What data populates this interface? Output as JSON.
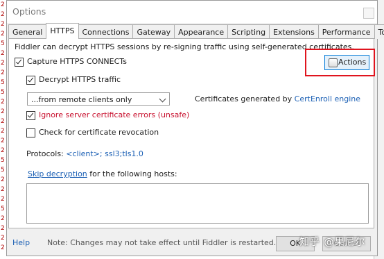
{
  "window": {
    "title": "Options"
  },
  "background": {
    "left_chars": [
      "2",
      "2",
      "2",
      "2",
      "5",
      "2",
      "2",
      "2",
      "5",
      "5",
      "2",
      "2",
      "2",
      "2",
      "2",
      "2",
      "5",
      "5",
      "2",
      "2",
      "2",
      "5",
      "2",
      "2",
      "2",
      "2",
      "2"
    ]
  },
  "tabs": [
    {
      "label": "General"
    },
    {
      "label": "HTTPS",
      "active": true
    },
    {
      "label": "Connections"
    },
    {
      "label": "Gateway"
    },
    {
      "label": "Appearance"
    },
    {
      "label": "Scripting"
    },
    {
      "label": "Extensions"
    },
    {
      "label": "Performance"
    },
    {
      "label": "Tools"
    }
  ],
  "https": {
    "intro": "Fiddler can decrypt HTTPS sessions by re-signing traffic using self-generated certificates.",
    "capture_label": "Capture HTTPS CONNECTs",
    "decrypt_label": "Decrypt HTTPS traffic",
    "source_select": "...from remote clients only",
    "cert_prefix": "Certificates generated by",
    "cert_engine": "CertEnroll engine",
    "ignore_errors_label": "Ignore server certificate errors (unsafe)",
    "revocation_label": "Check for certificate revocation",
    "protocols_label": "Protocols:",
    "protocols_value": "<client>; ssl3;tls1.0",
    "skip_link": "Skip decryption",
    "skip_suffix": "for the following hosts:",
    "actions_label": "Actions",
    "capture_checked": true,
    "decrypt_checked": true,
    "ignore_checked": true,
    "revocation_checked": false
  },
  "footer": {
    "help": "Help",
    "note": "Note: Changes may not take effect until Fiddler is restarted.",
    "ok": "OK",
    "cancel": "Cancel"
  },
  "watermark": "知乎 @果尼尔",
  "colors": {
    "highlight": "#e0141e",
    "link": "#1a5fb4",
    "warning": "#c8102e"
  }
}
